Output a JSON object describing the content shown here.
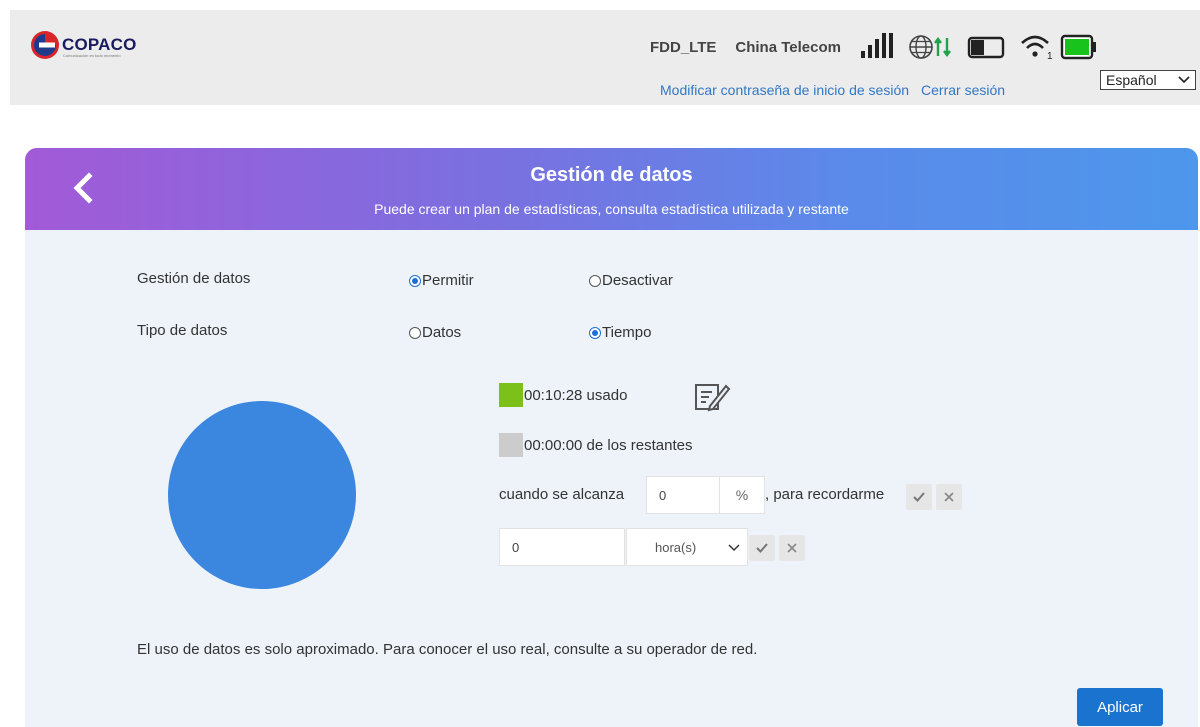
{
  "header": {
    "logo_text": "COPACO",
    "logo_subtext": "Comunicación en todo momento",
    "network_type": "FDD_LTE",
    "carrier": "China Telecom",
    "change_password_link": "Modificar contraseña de inicio de sesión",
    "logout_link": "Cerrar sesión",
    "language": "Español",
    "battery_level": 1.0,
    "colors": {
      "link": "#2f78c4",
      "battery": "#18c41c",
      "data_arrows": "#1fa24b"
    }
  },
  "panel": {
    "title": "Gestión de datos",
    "subtitle": "Puede crear un plan de estadísticas, consulta estadística utilizada y restante",
    "data_management": {
      "label": "Gestión de datos",
      "options": [
        "Permitir",
        "Desactivar"
      ],
      "selected": "Permitir"
    },
    "data_type": {
      "label": "Tipo de datos",
      "options": [
        "Datos",
        "Tiempo"
      ],
      "selected": "Tiempo"
    },
    "usage": {
      "used_text": "00:10:28 usado",
      "remaining_text": "00:00:00 de los restantes",
      "used_color": "#7cc11a",
      "remaining_color": "#cccccc",
      "pie_color": "#3b86df"
    },
    "reminder": {
      "prefix": "cuando se alcanza",
      "percent_value": "0",
      "percent_unit": "%",
      "suffix": ", para recordarme"
    },
    "limit": {
      "value": "0",
      "unit_selected": "hora(s)"
    },
    "note": "El uso de datos es solo aproximado. Para conocer el uso real, consulte a su operador de red.",
    "apply_label": "Aplicar"
  }
}
